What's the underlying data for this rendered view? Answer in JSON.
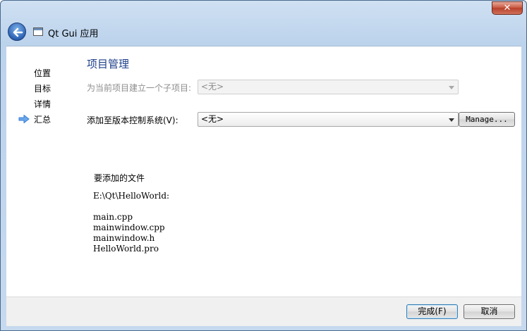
{
  "window": {
    "title": "Qt Gui 应用",
    "close_label": "✕"
  },
  "nav": {
    "items": [
      {
        "label": "位置"
      },
      {
        "label": "目标"
      },
      {
        "label": "详情"
      },
      {
        "label": "汇总",
        "current": true
      }
    ]
  },
  "page": {
    "title": "项目管理",
    "subproject_label": "为当前项目建立一个子项目:",
    "subproject_value": "<无>",
    "vcs_label": "添加至版本控制系统(V):",
    "vcs_value": "<无>",
    "manage_label": "Manage...",
    "files_heading": "要添加的文件",
    "files_path": "E:\\Qt\\HelloWorld:",
    "files": [
      "main.cpp",
      "mainwindow.cpp",
      "mainwindow.h",
      "HelloWorld.pro"
    ]
  },
  "footer": {
    "finish_label": "完成(F)",
    "cancel_label": "取消"
  },
  "colors": {
    "title_blue": "#1e3f8a",
    "disabled_text": "#8d8d8d",
    "nav_arrow": "#3a7fd5"
  },
  "icons": {
    "back": "back-arrow-icon",
    "app": "window-icon",
    "current_step": "current-step-arrow-icon",
    "dropdown": "chevron-down-icon"
  }
}
